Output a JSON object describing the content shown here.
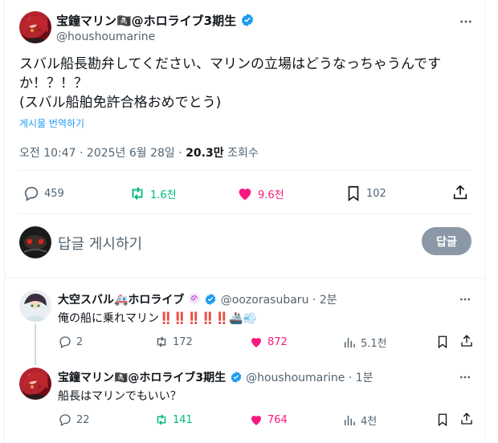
{
  "main_tweet": {
    "display_name": "宝鐘マリン🏴‍☠️@ホロライブ3期生",
    "handle": "@houshoumarine",
    "text_line1": "スバル船長勘弁してください、マリンの立場はどうなっちゃうんです",
    "text_line2": "か！？！？",
    "text_line3": "(スバル船舶免許合格おめでとう)",
    "translate_label": "게시물 번역하기",
    "time": "오전 10:47",
    "date": "2025년 6월 28일",
    "views_count": "20.3만",
    "views_label": "조회수",
    "reply_count": "459",
    "retweet_count": "1.6천",
    "like_count": "9.6천",
    "bookmark_count": "102"
  },
  "reply_box": {
    "placeholder": "답글 게시하기",
    "button_label": "답글"
  },
  "replies": [
    {
      "display_name": "大空スバル🚑ホロライブ",
      "handle": "@oozorasubaru",
      "time": "2분",
      "text": "俺の船に乗れマリン‼️‼️‼️‼️‼️🚢💨",
      "reply_count": "2",
      "retweet_count": "172",
      "like_count": "872",
      "views_count": "5.1천"
    },
    {
      "display_name": "宝鐘マリン🏴‍☠️@ホロライブ3期生",
      "handle": "@houshoumarine",
      "time": "1분",
      "text": "船長はマリンでもいい？",
      "reply_count": "22",
      "retweet_count": "141",
      "like_count": "764",
      "views_count": "4천"
    }
  ],
  "colors": {
    "verified": "#1d9bf0",
    "retweet": "#00ba7c",
    "like": "#f91880",
    "link": "#1d9bf0",
    "muted": "#536471"
  }
}
